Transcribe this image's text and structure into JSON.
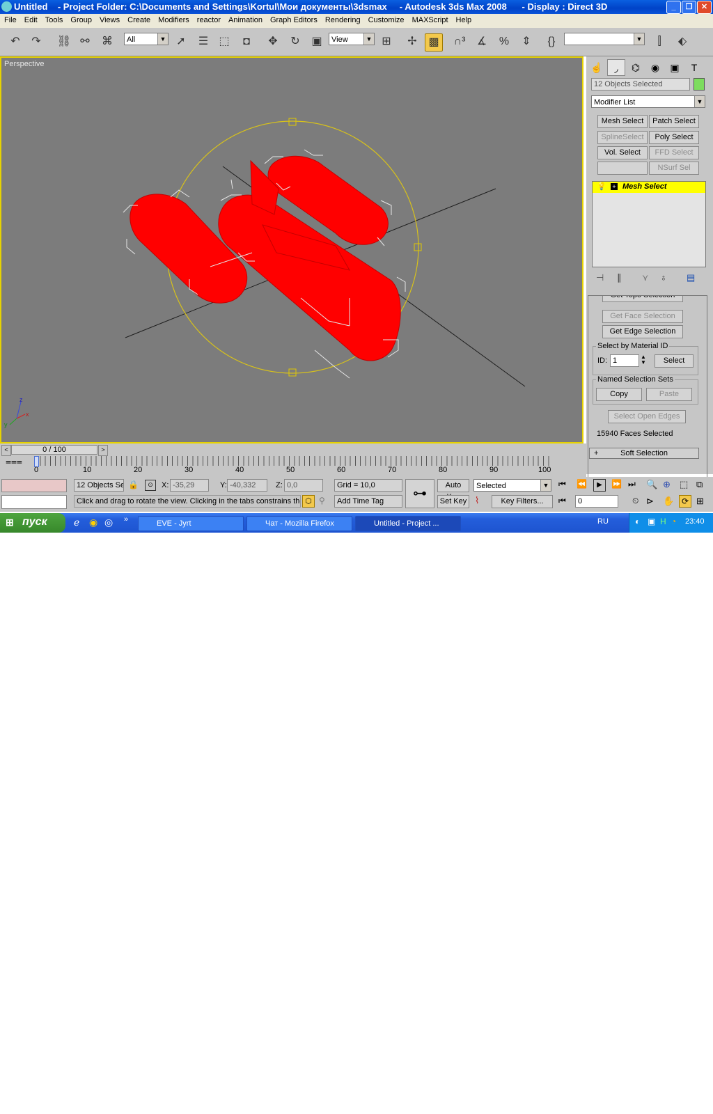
{
  "window": {
    "title": "Untitled    - Project Folder: C:\\Documents and Settings\\Kortul\\Мои документы\\3dsmax     - Autodesk 3ds Max 2008      - Display : Direct 3D"
  },
  "menu": [
    "File",
    "Edit",
    "Tools",
    "Group",
    "Views",
    "Create",
    "Modifiers",
    "reactor",
    "Animation",
    "Graph Editors",
    "Rendering",
    "Customize",
    "MAXScript",
    "Help"
  ],
  "toolbar": {
    "filter_value": "All",
    "refcoord_value": "View"
  },
  "viewport": {
    "label": "Perspective",
    "axis_x": "x",
    "axis_y": "y",
    "axis_z": "z"
  },
  "command_panel": {
    "selection_name": "12 Objects Selected",
    "modifier_list": "Modifier List",
    "buttons": [
      "Mesh Select",
      "Patch Select",
      "SplineSelect",
      "Poly Select",
      "Vol. Select",
      "FFD Select",
      "",
      "NSurf Sel"
    ],
    "stack_item": "Mesh Select",
    "get_topo": "Get Topo Selection",
    "get_face": "Get Face Selection",
    "get_edge": "Get Edge Selection",
    "matid_group": "Select by Material ID",
    "id_label": "ID:",
    "id_value": "1",
    "select_btn": "Select",
    "named_sets_group": "Named Selection Sets",
    "copy_btn": "Copy",
    "paste_btn": "Paste",
    "open_edges_btn": "Select Open Edges",
    "faces_selected": "15940 Faces Selected",
    "soft_selection": "Soft Selection",
    "soft_plus": "+"
  },
  "timeline": {
    "slider_text": "0 / 100",
    "ticks": [
      "0",
      "10",
      "20",
      "30",
      "40",
      "50",
      "60",
      "70",
      "80",
      "90",
      "100"
    ]
  },
  "status": {
    "selection_text": "12 Objects Se",
    "x_label": "X:",
    "x_value": "-35,29",
    "y_label": "Y:",
    "y_value": "-40,332",
    "z_label": "Z:",
    "z_value": "0,0",
    "grid": "Grid = 10,0",
    "auto_key": "Auto Key",
    "set_key": "Set Key",
    "key_mode": "Selected",
    "key_filters": "Key Filters...",
    "prompt": "Click and drag to rotate the view.  Clicking in the tabs constrains the",
    "add_time_tag": "Add Time Tag",
    "frame_value": "0"
  },
  "taskbar": {
    "start": "пуск",
    "tasks": [
      "EVE - Jyrt",
      "Чат - Mozilla Firefox",
      "Untitled      - Project ..."
    ],
    "lang": "RU",
    "clock": "23:40"
  },
  "colors": {
    "object": "#ff0000",
    "viewport_border": "#e6d200",
    "viewport_bg": "#7c7c7c",
    "selection_swatch": "#7ddc5e"
  }
}
